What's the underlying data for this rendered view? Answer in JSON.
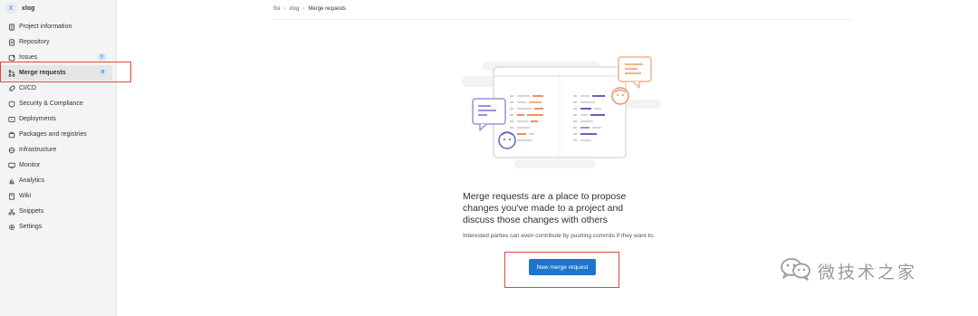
{
  "project": {
    "avatar_letter": "X",
    "name": "xlog"
  },
  "sidebar": {
    "items": [
      {
        "label": "Project information",
        "icon": "project-icon"
      },
      {
        "label": "Repository",
        "icon": "document-icon"
      },
      {
        "label": "Issues",
        "icon": "issues-icon",
        "count": "0"
      },
      {
        "label": "Merge requests",
        "icon": "merge-request-icon",
        "count": "0",
        "active": true
      },
      {
        "label": "CI/CD",
        "icon": "rocket-icon"
      },
      {
        "label": "Security & Compliance",
        "icon": "shield-icon"
      },
      {
        "label": "Deployments",
        "icon": "deployments-icon"
      },
      {
        "label": "Packages and registries",
        "icon": "package-icon"
      },
      {
        "label": "Infrastructure",
        "icon": "cloud-icon"
      },
      {
        "label": "Monitor",
        "icon": "monitor-icon"
      },
      {
        "label": "Analytics",
        "icon": "chart-icon"
      },
      {
        "label": "Wiki",
        "icon": "book-icon"
      },
      {
        "label": "Snippets",
        "icon": "scissors-icon"
      },
      {
        "label": "Settings",
        "icon": "gear-icon"
      }
    ]
  },
  "breadcrumb": {
    "items": [
      "fisi",
      "xlog",
      "Merge requests"
    ]
  },
  "empty_state": {
    "title": "Merge requests are a place to propose changes you've made to a project and discuss those changes with others",
    "description": "Interested parties can even contribute by pushing commits if they want to.",
    "button_label": "New merge request"
  },
  "watermark": {
    "text": "微技术之家",
    "icon": "wechat-icon"
  },
  "colors": {
    "primary": "#1f75cb",
    "annotation": "#e0483e",
    "sidebar_bg": "#f4f4f4",
    "orange": "#e9925e",
    "purple": "#6b5bc6"
  }
}
